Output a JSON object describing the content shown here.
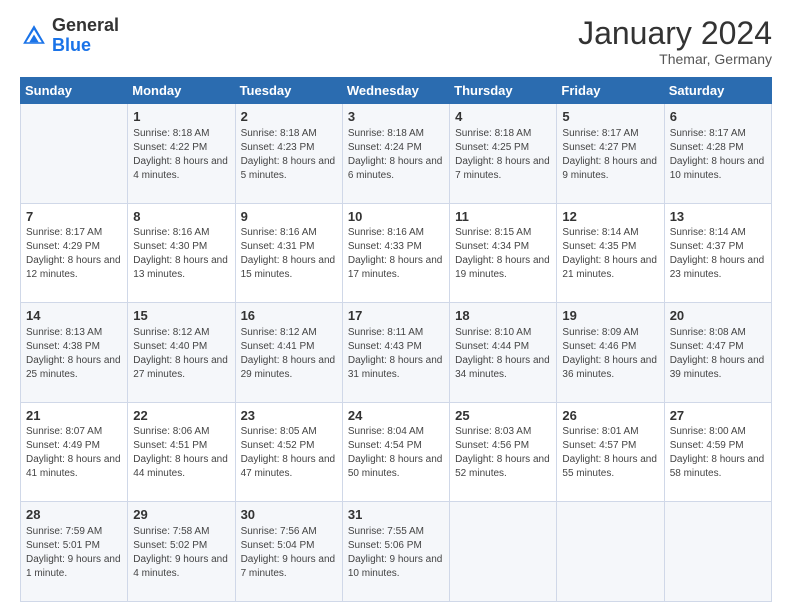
{
  "header": {
    "logo_general": "General",
    "logo_blue": "Blue",
    "title": "January 2024",
    "subtitle": "Themar, Germany"
  },
  "weekdays": [
    "Sunday",
    "Monday",
    "Tuesday",
    "Wednesday",
    "Thursday",
    "Friday",
    "Saturday"
  ],
  "weeks": [
    [
      {
        "day": "",
        "sunrise": "",
        "sunset": "",
        "daylight": "",
        "empty": true
      },
      {
        "day": "1",
        "sunrise": "Sunrise: 8:18 AM",
        "sunset": "Sunset: 4:22 PM",
        "daylight": "Daylight: 8 hours and 4 minutes."
      },
      {
        "day": "2",
        "sunrise": "Sunrise: 8:18 AM",
        "sunset": "Sunset: 4:23 PM",
        "daylight": "Daylight: 8 hours and 5 minutes."
      },
      {
        "day": "3",
        "sunrise": "Sunrise: 8:18 AM",
        "sunset": "Sunset: 4:24 PM",
        "daylight": "Daylight: 8 hours and 6 minutes."
      },
      {
        "day": "4",
        "sunrise": "Sunrise: 8:18 AM",
        "sunset": "Sunset: 4:25 PM",
        "daylight": "Daylight: 8 hours and 7 minutes."
      },
      {
        "day": "5",
        "sunrise": "Sunrise: 8:17 AM",
        "sunset": "Sunset: 4:27 PM",
        "daylight": "Daylight: 8 hours and 9 minutes."
      },
      {
        "day": "6",
        "sunrise": "Sunrise: 8:17 AM",
        "sunset": "Sunset: 4:28 PM",
        "daylight": "Daylight: 8 hours and 10 minutes."
      }
    ],
    [
      {
        "day": "7",
        "sunrise": "Sunrise: 8:17 AM",
        "sunset": "Sunset: 4:29 PM",
        "daylight": "Daylight: 8 hours and 12 minutes."
      },
      {
        "day": "8",
        "sunrise": "Sunrise: 8:16 AM",
        "sunset": "Sunset: 4:30 PM",
        "daylight": "Daylight: 8 hours and 13 minutes."
      },
      {
        "day": "9",
        "sunrise": "Sunrise: 8:16 AM",
        "sunset": "Sunset: 4:31 PM",
        "daylight": "Daylight: 8 hours and 15 minutes."
      },
      {
        "day": "10",
        "sunrise": "Sunrise: 8:16 AM",
        "sunset": "Sunset: 4:33 PM",
        "daylight": "Daylight: 8 hours and 17 minutes."
      },
      {
        "day": "11",
        "sunrise": "Sunrise: 8:15 AM",
        "sunset": "Sunset: 4:34 PM",
        "daylight": "Daylight: 8 hours and 19 minutes."
      },
      {
        "day": "12",
        "sunrise": "Sunrise: 8:14 AM",
        "sunset": "Sunset: 4:35 PM",
        "daylight": "Daylight: 8 hours and 21 minutes."
      },
      {
        "day": "13",
        "sunrise": "Sunrise: 8:14 AM",
        "sunset": "Sunset: 4:37 PM",
        "daylight": "Daylight: 8 hours and 23 minutes."
      }
    ],
    [
      {
        "day": "14",
        "sunrise": "Sunrise: 8:13 AM",
        "sunset": "Sunset: 4:38 PM",
        "daylight": "Daylight: 8 hours and 25 minutes."
      },
      {
        "day": "15",
        "sunrise": "Sunrise: 8:12 AM",
        "sunset": "Sunset: 4:40 PM",
        "daylight": "Daylight: 8 hours and 27 minutes."
      },
      {
        "day": "16",
        "sunrise": "Sunrise: 8:12 AM",
        "sunset": "Sunset: 4:41 PM",
        "daylight": "Daylight: 8 hours and 29 minutes."
      },
      {
        "day": "17",
        "sunrise": "Sunrise: 8:11 AM",
        "sunset": "Sunset: 4:43 PM",
        "daylight": "Daylight: 8 hours and 31 minutes."
      },
      {
        "day": "18",
        "sunrise": "Sunrise: 8:10 AM",
        "sunset": "Sunset: 4:44 PM",
        "daylight": "Daylight: 8 hours and 34 minutes."
      },
      {
        "day": "19",
        "sunrise": "Sunrise: 8:09 AM",
        "sunset": "Sunset: 4:46 PM",
        "daylight": "Daylight: 8 hours and 36 minutes."
      },
      {
        "day": "20",
        "sunrise": "Sunrise: 8:08 AM",
        "sunset": "Sunset: 4:47 PM",
        "daylight": "Daylight: 8 hours and 39 minutes."
      }
    ],
    [
      {
        "day": "21",
        "sunrise": "Sunrise: 8:07 AM",
        "sunset": "Sunset: 4:49 PM",
        "daylight": "Daylight: 8 hours and 41 minutes."
      },
      {
        "day": "22",
        "sunrise": "Sunrise: 8:06 AM",
        "sunset": "Sunset: 4:51 PM",
        "daylight": "Daylight: 8 hours and 44 minutes."
      },
      {
        "day": "23",
        "sunrise": "Sunrise: 8:05 AM",
        "sunset": "Sunset: 4:52 PM",
        "daylight": "Daylight: 8 hours and 47 minutes."
      },
      {
        "day": "24",
        "sunrise": "Sunrise: 8:04 AM",
        "sunset": "Sunset: 4:54 PM",
        "daylight": "Daylight: 8 hours and 50 minutes."
      },
      {
        "day": "25",
        "sunrise": "Sunrise: 8:03 AM",
        "sunset": "Sunset: 4:56 PM",
        "daylight": "Daylight: 8 hours and 52 minutes."
      },
      {
        "day": "26",
        "sunrise": "Sunrise: 8:01 AM",
        "sunset": "Sunset: 4:57 PM",
        "daylight": "Daylight: 8 hours and 55 minutes."
      },
      {
        "day": "27",
        "sunrise": "Sunrise: 8:00 AM",
        "sunset": "Sunset: 4:59 PM",
        "daylight": "Daylight: 8 hours and 58 minutes."
      }
    ],
    [
      {
        "day": "28",
        "sunrise": "Sunrise: 7:59 AM",
        "sunset": "Sunset: 5:01 PM",
        "daylight": "Daylight: 9 hours and 1 minute."
      },
      {
        "day": "29",
        "sunrise": "Sunrise: 7:58 AM",
        "sunset": "Sunset: 5:02 PM",
        "daylight": "Daylight: 9 hours and 4 minutes."
      },
      {
        "day": "30",
        "sunrise": "Sunrise: 7:56 AM",
        "sunset": "Sunset: 5:04 PM",
        "daylight": "Daylight: 9 hours and 7 minutes."
      },
      {
        "day": "31",
        "sunrise": "Sunrise: 7:55 AM",
        "sunset": "Sunset: 5:06 PM",
        "daylight": "Daylight: 9 hours and 10 minutes."
      },
      {
        "day": "",
        "sunrise": "",
        "sunset": "",
        "daylight": "",
        "empty": true
      },
      {
        "day": "",
        "sunrise": "",
        "sunset": "",
        "daylight": "",
        "empty": true
      },
      {
        "day": "",
        "sunrise": "",
        "sunset": "",
        "daylight": "",
        "empty": true
      }
    ]
  ]
}
